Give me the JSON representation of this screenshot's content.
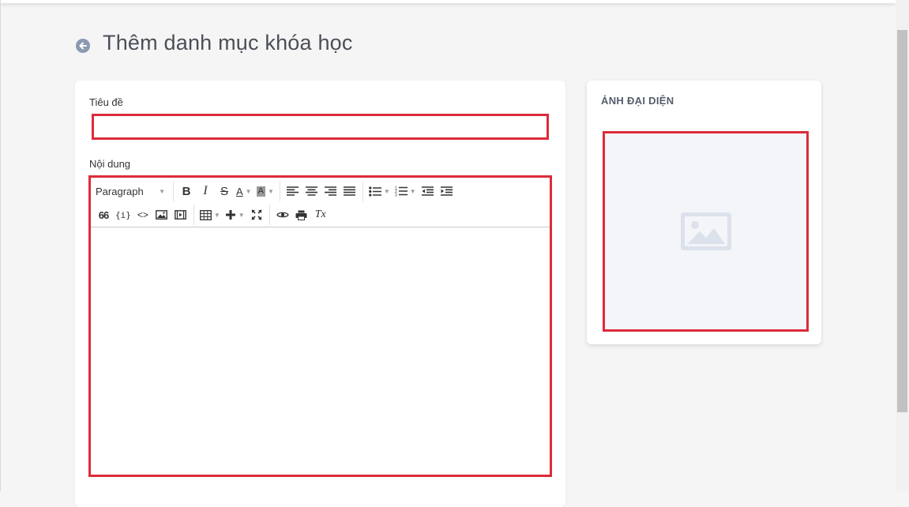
{
  "header": {
    "title": "Thêm danh mục khóa học",
    "back_icon": "arrow-left-circle-icon"
  },
  "form": {
    "title_label": "Tiêu đề",
    "title_value": "",
    "title_placeholder": "",
    "content_label": "Nội dung",
    "content_value": ""
  },
  "editor": {
    "format_select": "Paragraph",
    "toolbar_row1": [
      "bold-icon",
      "italic-icon",
      "strikethrough-icon",
      "text-color-icon",
      "background-color-icon",
      "align-left-icon",
      "align-center-icon",
      "align-right-icon",
      "align-justify-icon",
      "bullet-list-icon",
      "numbered-list-icon",
      "outdent-icon",
      "indent-icon"
    ],
    "toolbar_row2": [
      "blockquote-icon",
      "code-sample-icon",
      "source-code-icon",
      "image-icon",
      "media-icon",
      "table-icon",
      "insert-icon",
      "fullscreen-icon",
      "preview-icon",
      "print-icon",
      "clear-format-icon"
    ],
    "letter_bold": "B",
    "letter_italic": "I",
    "letter_strike": "S",
    "letter_color": "A",
    "letter_bg": "A",
    "quote_glyph": "66",
    "code_glyph": "{i}",
    "source_glyph": "<>",
    "clear_glyph": "Tx"
  },
  "sidebar": {
    "title": "ẢNH ĐẠI DIỆN",
    "image_icon": "image-placeholder-icon"
  },
  "colors": {
    "highlight": "#dc2b3a",
    "title": "#4b4f56",
    "placeholder_icon": "#dbe2ec"
  }
}
